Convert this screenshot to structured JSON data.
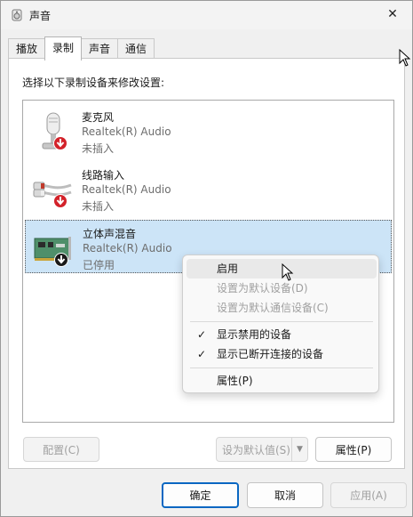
{
  "window": {
    "title": "声音",
    "close_glyph": "✕"
  },
  "tabs": [
    {
      "label": "播放",
      "active": false
    },
    {
      "label": "录制",
      "active": true
    },
    {
      "label": "声音",
      "active": false
    },
    {
      "label": "通信",
      "active": false
    }
  ],
  "panel": {
    "prompt": "选择以下录制设备来修改设置:"
  },
  "devices": [
    {
      "name": "麦克风",
      "driver": "Realtek(R) Audio",
      "status": "未插入",
      "icon": "microphone-icon",
      "badge": "unplugged-badge-icon"
    },
    {
      "name": "线路输入",
      "driver": "Realtek(R) Audio",
      "status": "未插入",
      "icon": "line-in-cable-icon",
      "badge": "unplugged-badge-icon"
    },
    {
      "name": "立体声混音",
      "driver": "Realtek(R) Audio",
      "status": "已停用",
      "icon": "sound-card-icon",
      "badge": "disabled-badge-icon"
    }
  ],
  "context_menu": {
    "items": [
      {
        "label": "启用",
        "disabled": false,
        "checked": false
      },
      {
        "label": "设置为默认设备(D)",
        "disabled": true,
        "checked": false
      },
      {
        "label": "设置为默认通信设备(C)",
        "disabled": true,
        "checked": false
      },
      {
        "label": "显示禁用的设备",
        "disabled": false,
        "checked": true
      },
      {
        "label": "显示已断开连接的设备",
        "disabled": false,
        "checked": true
      },
      {
        "label": "属性(P)",
        "disabled": false,
        "checked": false
      }
    ],
    "check_glyph": "✓"
  },
  "panel_buttons": {
    "configure": "配置(C)",
    "set_default": "设为默认值(S)",
    "properties": "属性(P)"
  },
  "dialog_buttons": {
    "ok": "确定",
    "cancel": "取消",
    "apply": "应用(A)"
  },
  "colors": {
    "accent": "#0a67c2",
    "selection": "#cce4f7",
    "badge_red": "#d3222a"
  }
}
